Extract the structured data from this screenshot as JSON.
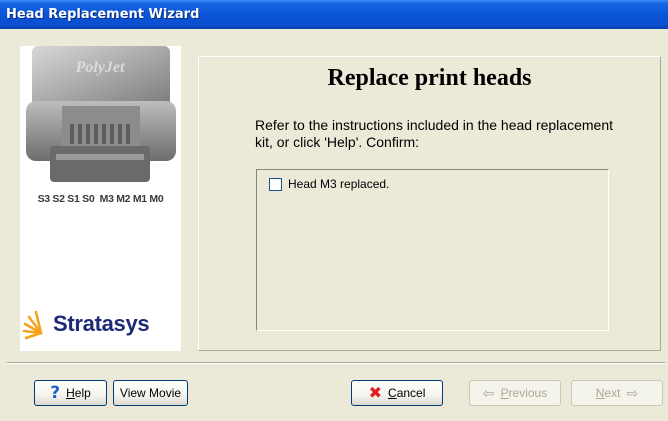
{
  "window": {
    "title": "Head Replacement Wizard"
  },
  "sidebar": {
    "slot_labels": "S3 S2 S1 S0  M3 M2 M1 M0",
    "logo_text": "Stratasys",
    "logo_mark_color": "#f7a21b",
    "logo_text_color": "#1d2a78"
  },
  "panel": {
    "title": "Replace print heads",
    "instruction": "Refer to the instructions included in the head replacement kit, or click 'Help'. Confirm:",
    "confirm_items": [
      {
        "label": "Head M3 replaced.",
        "checked": false
      }
    ]
  },
  "buttons": {
    "help": {
      "icon": "question-mark-icon",
      "label_mnemonic": "H",
      "label_rest": "elp"
    },
    "view_movie": {
      "label": "View Movie"
    },
    "cancel": {
      "icon": "red-x-icon",
      "label_mnemonic": "C",
      "label_rest": "ancel"
    },
    "previous": {
      "icon": "left-arrow-icon",
      "label_mnemonic": "P",
      "label_rest": "revious",
      "enabled": false
    },
    "next": {
      "icon": "right-arrow-icon",
      "label_mnemonic": "N",
      "label_rest": "ext",
      "enabled": false
    }
  },
  "colors": {
    "titlebar": "#0a55d8",
    "dialog_bg": "#ece9d8",
    "button_border": "#003c74",
    "help_icon": "#1d5fd0",
    "cancel_icon": "#e31e1e"
  }
}
